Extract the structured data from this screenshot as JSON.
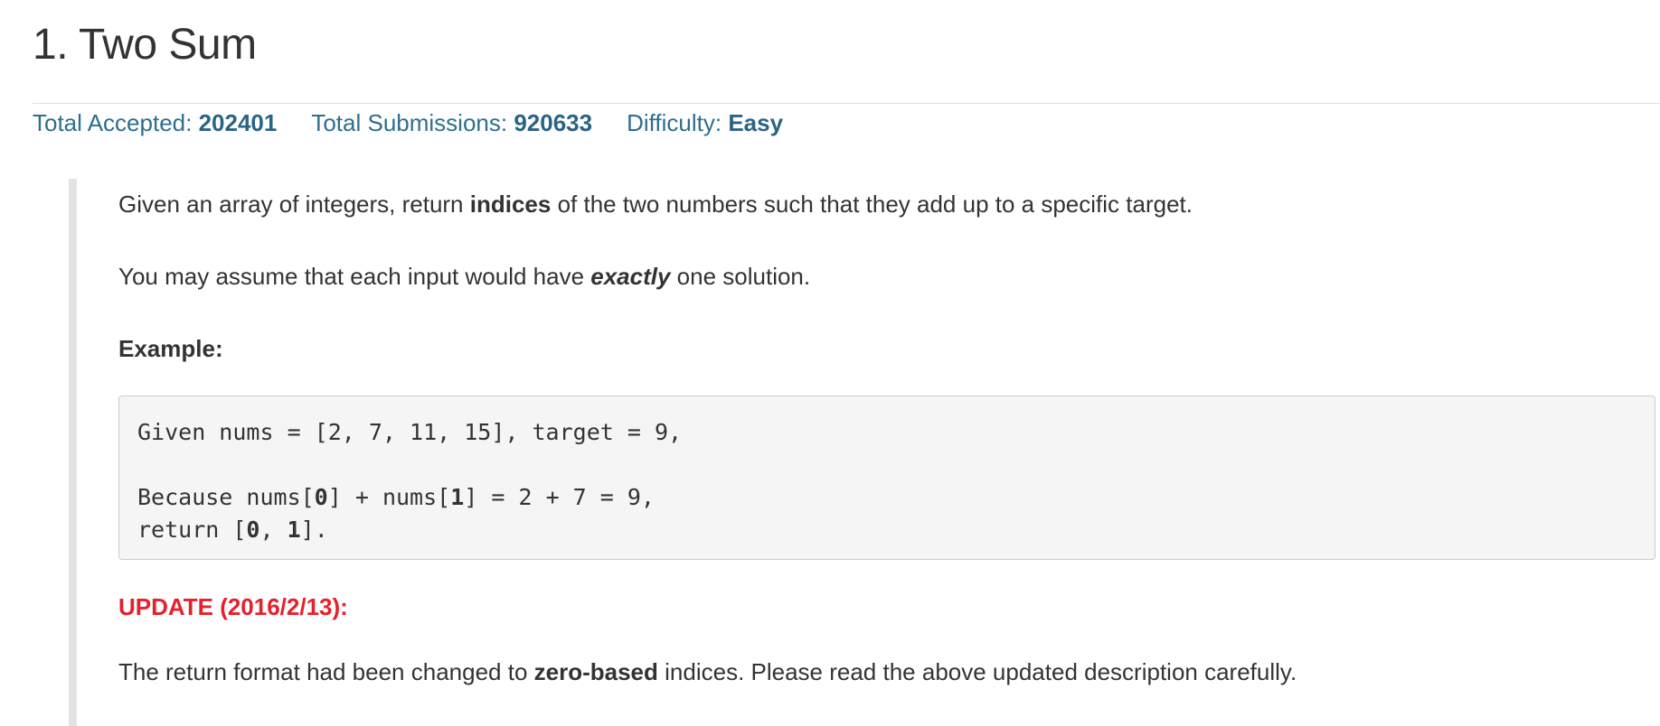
{
  "problem": {
    "title": "1. Two Sum"
  },
  "stats": {
    "accepted_label": "Total Accepted:",
    "accepted_value": "202401",
    "submissions_label": "Total Submissions:",
    "submissions_value": "920633",
    "difficulty_label": "Difficulty:",
    "difficulty_value": "Easy"
  },
  "description": {
    "p1_before": "Given an array of integers, return ",
    "p1_bold": "indices",
    "p1_after": " of the two numbers such that they add up to a specific target.",
    "p2_before": "You may assume that each input would have ",
    "p2_bold_italic": "exactly",
    "p2_after": " one solution.",
    "example_heading": "Example:",
    "code": {
      "line1": "Given nums = [2, 7, 11, 15], target = 9,",
      "line3_a": "Because nums[",
      "line3_b": "0",
      "line3_c": "] + nums[",
      "line3_d": "1",
      "line3_e": "] = 2 + 7 = 9,",
      "line4_a": "return [",
      "line4_b": "0",
      "line4_c": ", ",
      "line4_d": "1",
      "line4_e": "]."
    },
    "update_heading": "UPDATE (2016/2/13):",
    "p5_before": "The return format had been changed to ",
    "p5_bold": "zero-based",
    "p5_after": " indices. Please read the above updated description carefully."
  }
}
